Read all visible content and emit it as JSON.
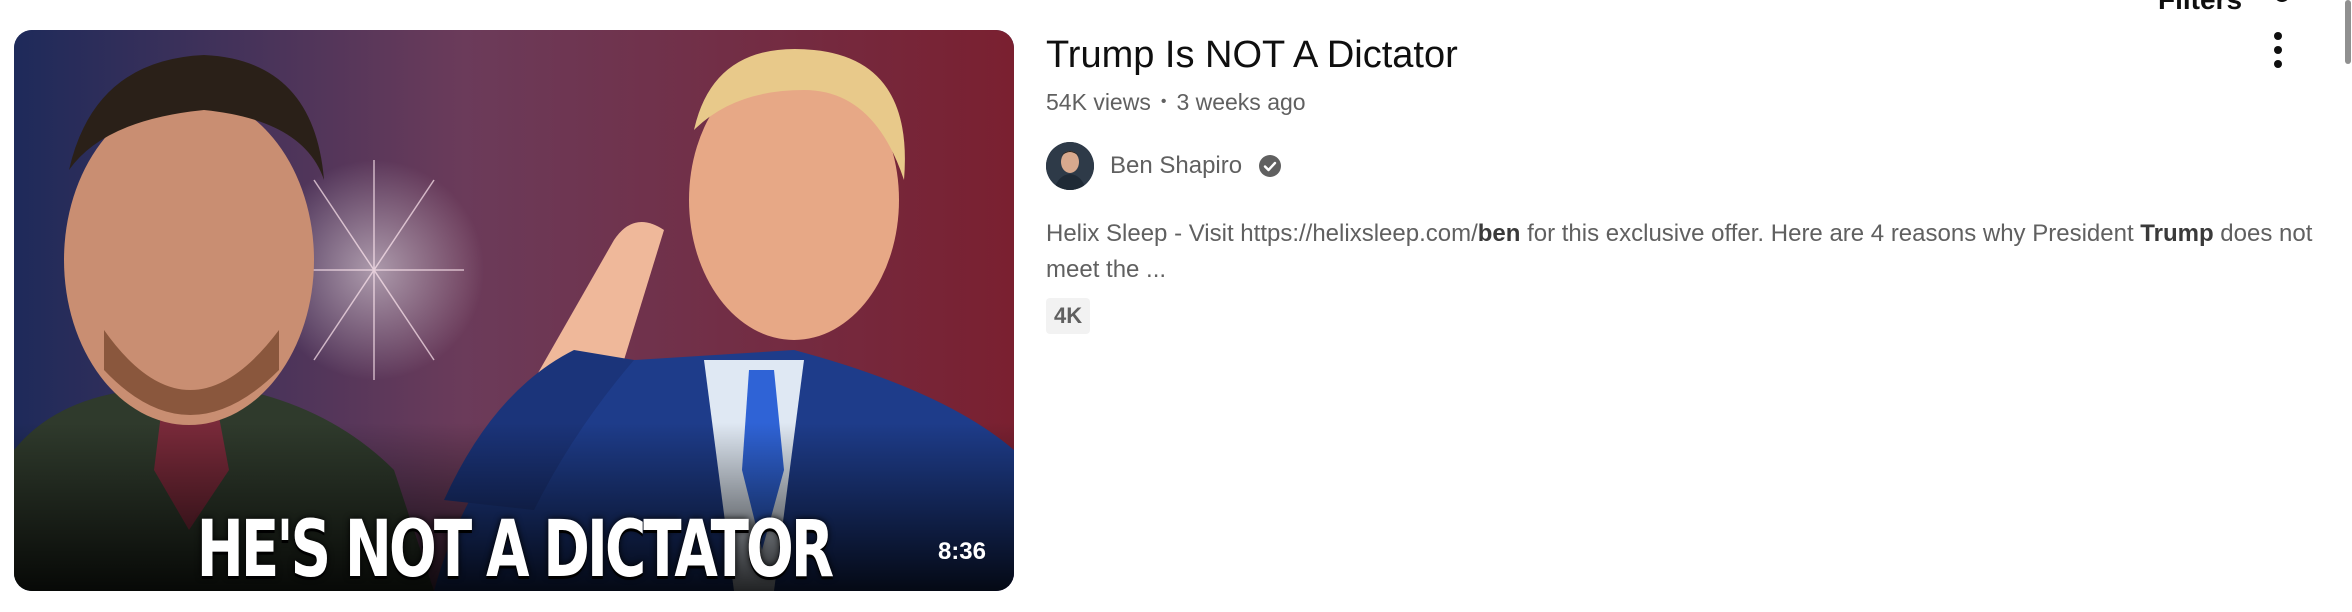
{
  "filters": {
    "label": "Filters",
    "icon": "filters-icon"
  },
  "video": {
    "thumbnail_caption": "HE'S NOT A DICTATOR",
    "duration": "8:36",
    "title": "Trump Is NOT A Dictator",
    "views": "54K views",
    "age": "3 weeks ago",
    "channel": {
      "name": "Ben Shapiro",
      "verified_icon": "verified-check-icon"
    },
    "description": {
      "p1": "Helix Sleep - Visit https://helixsleep.com/",
      "b1": "ben",
      "p2": " for this exclusive offer. Here are 4 reasons why President ",
      "b2": "Trump",
      "p3": " does not meet the ..."
    },
    "badge": "4K",
    "menu_icon": "more-vert-icon"
  },
  "colors": {
    "text_primary": "#0f0f0f",
    "text_secondary": "#606060",
    "badge_bg": "#f2f2f2"
  }
}
